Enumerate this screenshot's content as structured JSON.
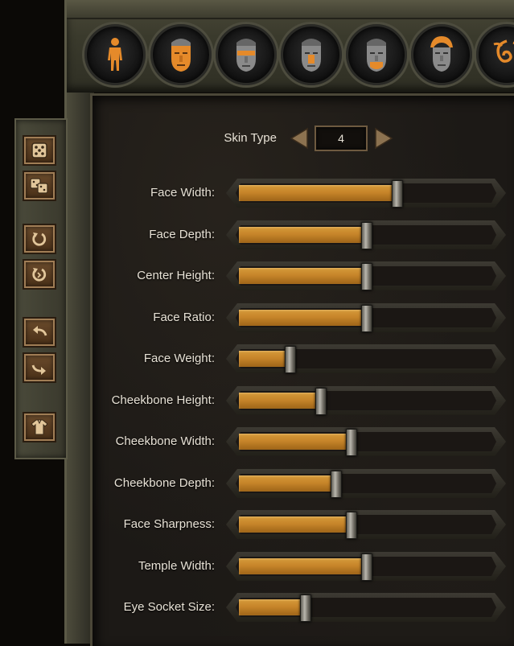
{
  "tabs": [
    {
      "icon": "body-icon",
      "active": true
    },
    {
      "icon": "face-icon",
      "active": true
    },
    {
      "icon": "eyes-icon"
    },
    {
      "icon": "nose-icon"
    },
    {
      "icon": "mouth-icon"
    },
    {
      "icon": "hair-icon"
    },
    {
      "icon": "tattoo-icon"
    }
  ],
  "toolbar": [
    {
      "icon": "randomize-icon"
    },
    {
      "icon": "randomize-all-icon"
    },
    {
      "icon": "reset-icon"
    },
    {
      "icon": "reset-all-icon"
    },
    {
      "icon": "undo-icon"
    },
    {
      "icon": "redo-icon"
    },
    {
      "icon": "clothing-icon"
    }
  ],
  "skin": {
    "label": "Skin Type",
    "value": "4"
  },
  "sliders": [
    {
      "label": "Face Width:",
      "value": 0.62
    },
    {
      "label": "Face Depth:",
      "value": 0.5
    },
    {
      "label": "Center Height:",
      "value": 0.5
    },
    {
      "label": "Face Ratio:",
      "value": 0.5
    },
    {
      "label": "Face Weight:",
      "value": 0.2
    },
    {
      "label": "Cheekbone Height:",
      "value": 0.32
    },
    {
      "label": "Cheekbone Width:",
      "value": 0.44
    },
    {
      "label": "Cheekbone Depth:",
      "value": 0.38
    },
    {
      "label": "Face Sharpness:",
      "value": 0.44
    },
    {
      "label": "Temple Width:",
      "value": 0.5
    },
    {
      "label": "Eye Socket Size:",
      "value": 0.26
    }
  ],
  "colors": {
    "accent": "#e08a2a",
    "fill": "#c7852a",
    "text": "#e8e2d6"
  }
}
